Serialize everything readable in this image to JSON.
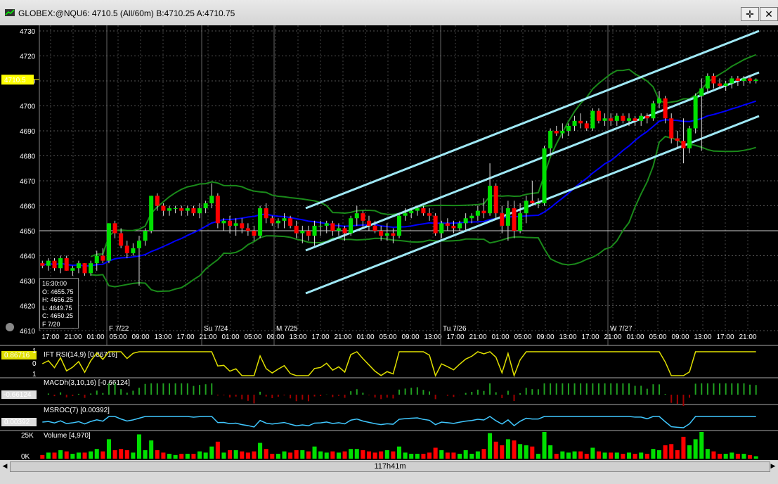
{
  "window": {
    "title": "GLOBEX:@NQU6: 4710.5 (All/60m)  B:4710.25 A:4710.75",
    "btn_crosshair": "✛",
    "btn_close": "✕"
  },
  "chart_data": {
    "type": "candlestick",
    "price_axis": {
      "ticks": [
        "4730",
        "4720",
        "4710",
        "4700",
        "4690",
        "4680",
        "4670",
        "4660",
        "4650",
        "4640",
        "4630",
        "4620",
        "4610"
      ],
      "ylim": [
        4610,
        4730
      ]
    },
    "current_price": "4710.5",
    "time_axis": [
      "17:00",
      "21:00",
      "01:00",
      "05:00",
      "09:00",
      "13:00",
      "17:00",
      "21:00",
      "01:00",
      "05:00",
      "09:00",
      "13:00",
      "17:00",
      "21:00",
      "01:00",
      "05:00",
      "09:00",
      "13:00",
      "17:00",
      "21:00",
      "01:00",
      "05:00",
      "09:00",
      "13:00",
      "17:00",
      "21:00",
      "01:00",
      "05:00",
      "09:00",
      "13:00",
      "17:00",
      "21:00"
    ],
    "day_labels": [
      "F  7/22",
      "Su 7/24",
      "M  7/25",
      "Tu 7/26",
      "W  7/27"
    ],
    "ohlc_tooltip": {
      "time": "16:30:00",
      "open": "O: 4655.75",
      "high": "H: 4656.25",
      "low": "L: 4649.75",
      "close": "C: 4650.25",
      "date": "F 7/20"
    },
    "candles": [
      [
        4637,
        4638,
        4635,
        4636
      ],
      [
        4636,
        4639,
        4634,
        4638
      ],
      [
        4638,
        4639,
        4634,
        4635
      ],
      [
        4635,
        4640,
        4633,
        4639
      ],
      [
        4639,
        4640,
        4634,
        4634
      ],
      [
        4634,
        4636,
        4632,
        4635
      ],
      [
        4635,
        4638,
        4633,
        4637
      ],
      [
        4637,
        4637,
        4632,
        4633
      ],
      [
        4633,
        4638,
        4632,
        4637
      ],
      [
        4637,
        4642,
        4634,
        4640
      ],
      [
        4640,
        4643,
        4637,
        4638
      ],
      [
        4638,
        4653,
        4637,
        4653
      ],
      [
        4653,
        4654,
        4647,
        4649
      ],
      [
        4649,
        4651,
        4643,
        4644
      ],
      [
        4644,
        4646,
        4639,
        4641
      ],
      [
        4641,
        4645,
        4640,
        4643
      ],
      [
        4643,
        4648,
        4628,
        4646
      ],
      [
        4646,
        4651,
        4644,
        4650
      ],
      [
        4650,
        4664,
        4649,
        4664
      ],
      [
        4664,
        4665,
        4658,
        4660
      ],
      [
        4660,
        4661,
        4656,
        4658
      ],
      [
        4658,
        4660,
        4656,
        4659
      ],
      [
        4659,
        4660,
        4657,
        4659
      ],
      [
        4659,
        4660,
        4656,
        4658
      ],
      [
        4658,
        4660,
        4656,
        4659
      ],
      [
        4659,
        4660,
        4656,
        4657
      ],
      [
        4657,
        4661,
        4655,
        4659
      ],
      [
        4659,
        4662,
        4657,
        4661
      ],
      [
        4661,
        4669,
        4659,
        4664
      ],
      [
        4664,
        4665,
        4651,
        4653
      ],
      [
        4653,
        4655,
        4650,
        4654
      ],
      [
        4654,
        4656,
        4649,
        4652
      ],
      [
        4652,
        4655,
        4648,
        4653
      ],
      [
        4653,
        4655,
        4649,
        4651
      ],
      [
        4651,
        4653,
        4648,
        4650
      ],
      [
        4650,
        4652,
        4646,
        4648
      ],
      [
        4648,
        4660,
        4647,
        4659
      ],
      [
        4659,
        4661,
        4653,
        4655
      ],
      [
        4655,
        4656,
        4652,
        4653
      ],
      [
        4653,
        4655,
        4651,
        4654
      ],
      [
        4654,
        4657,
        4651,
        4655
      ],
      [
        4655,
        4656,
        4651,
        4652
      ],
      [
        4652,
        4654,
        4647,
        4649
      ],
      [
        4649,
        4652,
        4645,
        4650
      ],
      [
        4650,
        4652,
        4646,
        4648
      ],
      [
        4648,
        4654,
        4644,
        4652
      ],
      [
        4652,
        4654,
        4648,
        4652
      ],
      [
        4652,
        4654,
        4649,
        4653
      ],
      [
        4653,
        4654,
        4648,
        4650
      ],
      [
        4650,
        4653,
        4648,
        4651
      ],
      [
        4651,
        4652,
        4646,
        4649
      ],
      [
        4649,
        4656,
        4648,
        4655
      ],
      [
        4655,
        4660,
        4652,
        4657
      ],
      [
        4657,
        4658,
        4651,
        4654
      ],
      [
        4654,
        4656,
        4650,
        4652
      ],
      [
        4652,
        4654,
        4649,
        4650
      ],
      [
        4650,
        4652,
        4646,
        4648
      ],
      [
        4648,
        4653,
        4646,
        4649
      ],
      [
        4649,
        4651,
        4645,
        4648
      ],
      [
        4648,
        4657,
        4647,
        4656
      ],
      [
        4656,
        4659,
        4654,
        4657
      ],
      [
        4657,
        4659,
        4655,
        4658
      ],
      [
        4658,
        4660,
        4656,
        4659
      ],
      [
        4659,
        4660,
        4656,
        4657
      ],
      [
        4657,
        4659,
        4654,
        4656
      ],
      [
        4656,
        4657,
        4648,
        4649
      ],
      [
        4649,
        4654,
        4647,
        4653
      ],
      [
        4653,
        4655,
        4650,
        4652
      ],
      [
        4652,
        4654,
        4649,
        4651
      ],
      [
        4651,
        4654,
        4650,
        4653
      ],
      [
        4653,
        4657,
        4650,
        4655
      ],
      [
        4655,
        4657,
        4653,
        4656
      ],
      [
        4656,
        4660,
        4654,
        4658
      ],
      [
        4658,
        4663,
        4655,
        4657
      ],
      [
        4657,
        4677,
        4656,
        4668
      ],
      [
        4668,
        4669,
        4655,
        4657
      ],
      [
        4657,
        4660,
        4649,
        4652
      ],
      [
        4652,
        4662,
        4646,
        4659
      ],
      [
        4659,
        4662,
        4647,
        4650
      ],
      [
        4650,
        4661,
        4649,
        4657
      ],
      [
        4657,
        4664,
        4653,
        4662
      ],
      [
        4662,
        4670,
        4660,
        4661
      ],
      [
        4661,
        4663,
        4659,
        4661
      ],
      [
        4661,
        4684,
        4660,
        4683
      ],
      [
        4683,
        4691,
        4680,
        4690
      ],
      [
        4690,
        4692,
        4688,
        4689
      ],
      [
        4689,
        4693,
        4687,
        4690
      ],
      [
        4690,
        4693,
        4688,
        4692
      ],
      [
        4692,
        4696,
        4690,
        4694
      ],
      [
        4694,
        4697,
        4691,
        4693
      ],
      [
        4693,
        4694,
        4690,
        4691
      ],
      [
        4691,
        4699,
        4690,
        4698
      ],
      [
        4698,
        4699,
        4693,
        4694
      ],
      [
        4694,
        4697,
        4692,
        4695
      ],
      [
        4695,
        4697,
        4692,
        4694
      ],
      [
        4694,
        4697,
        4692,
        4696
      ],
      [
        4696,
        4697,
        4693,
        4694
      ],
      [
        4694,
        4697,
        4692,
        4695
      ],
      [
        4695,
        4696,
        4692,
        4694
      ],
      [
        4694,
        4697,
        4692,
        4696
      ],
      [
        4696,
        4697,
        4693,
        4695
      ],
      [
        4695,
        4702,
        4694,
        4701
      ],
      [
        4701,
        4706,
        4699,
        4703
      ],
      [
        4703,
        4704,
        4693,
        4695
      ],
      [
        4695,
        4697,
        4685,
        4687
      ],
      [
        4687,
        4690,
        4683,
        4686
      ],
      [
        4686,
        4695,
        4677,
        4683
      ],
      [
        4683,
        4692,
        4681,
        4691
      ],
      [
        4691,
        4705,
        4689,
        4704
      ],
      [
        4704,
        4711,
        4682,
        4707
      ],
      [
        4707,
        4713,
        4705,
        4712
      ],
      [
        4712,
        4713,
        4707,
        4709
      ],
      [
        4709,
        4711,
        4707,
        4708
      ],
      [
        4708,
        4710,
        4706,
        4709
      ],
      [
        4709,
        4712,
        4707,
        4711
      ],
      [
        4711,
        4712,
        4708,
        4710
      ],
      [
        4710,
        4712,
        4708,
        4711
      ],
      [
        4711,
        4712,
        4709,
        4710
      ],
      [
        4710,
        4711,
        4709,
        4710.5
      ]
    ],
    "indicators": [
      {
        "name": "IFT RSI(14,9)",
        "label": "IFT RSI(14,9)",
        "value_label": "[0.86716]",
        "value": "0.86716",
        "ticks": [
          "1",
          "0",
          "1"
        ]
      },
      {
        "name": "MACDh(3,10,16)",
        "label": "MACDh(3,10,16)",
        "value_label": "[-0.66124]",
        "value": "-0.66124"
      },
      {
        "name": "MSROC(7)",
        "label": "MSROC(7)",
        "value_label": "[0.00392]",
        "value": "0.00392"
      },
      {
        "name": "Volume",
        "label": "Volume",
        "value_label": "[4,970]",
        "ticks": [
          "25K",
          "0K"
        ]
      }
    ],
    "scroll_label": "117h41m"
  },
  "colors": {
    "bull": "#00e000",
    "bear": "#ff0000",
    "ma": "#0000ff",
    "band": "#1a8a1a",
    "channel": "#9fe8f5",
    "rsi": "#e0e000",
    "macd_pos": "#20a020",
    "macd_neg": "#a00000",
    "roc": "#40c8ff"
  }
}
